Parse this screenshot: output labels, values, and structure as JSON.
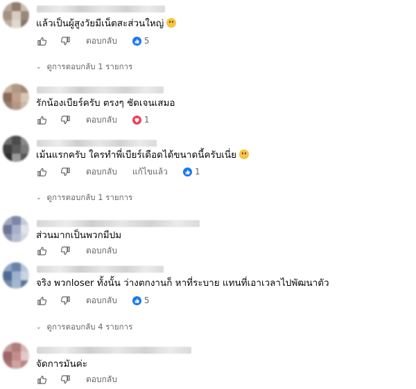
{
  "ui": {
    "reply_label": "ตอบกลับ",
    "edited_label": "แก้ไขแล้ว",
    "chevron": "⌄"
  },
  "comments": [
    {
      "text": "แล้วเป็นผู้สูงวัยมีเน็ตสะส่วนใหญ่",
      "emoji": "grinning-face-emoji",
      "reaction": {
        "type": "like",
        "count": "5"
      },
      "replies_label": "ดูการตอบกลับ 1 รายการ",
      "avatar_colors": [
        "#b8a79a",
        "#8f7c6e",
        "#cbbfb4",
        "#a39184",
        "#d8cdc3",
        "#97887c",
        "#bfae9f",
        "#e1d9d1",
        "#877666"
      ]
    },
    {
      "text": "รักน้องเบียร์ครับ ตรงๆ ชัดเจนเสมอ",
      "reaction": {
        "type": "love",
        "count": "1"
      },
      "avatar_colors": [
        "#c9b3a2",
        "#b39683",
        "#a48676",
        "#8b6a5a",
        "#c2a089",
        "#d9c5b6",
        "#9a7a6b",
        "#b49786",
        "#cdb6a5"
      ]
    },
    {
      "text": "เม้นแรกครับ ใครทำพี่เบียร์เดือดได้ขนาดนี้ครับเนี่ย",
      "emoji": "astonished-face-emoji",
      "edited": true,
      "reaction": {
        "type": "like",
        "count": "1"
      },
      "replies_label": "ดูการตอบกลับ 1 รายการ",
      "avatar_colors": [
        "#6e6e6e",
        "#4b4b4b",
        "#8a8a8a",
        "#3e3e3e",
        "#5c5c5c",
        "#7a7a7a",
        "#2f2f2f",
        "#9a9a9a",
        "#565656"
      ]
    },
    {
      "text": "ส่วนมากเป็นพวกมีปม",
      "avatar_colors": [
        "#9fa7c0",
        "#7b86a8",
        "#c5cad8",
        "#6d7596",
        "#a9b1c8",
        "#e0e3ea",
        "#8c93ad",
        "#b7bdd0",
        "#d2d5df"
      ]
    },
    {
      "text": "จริง พวกloser ทั้งนั้น ว่างตกงานก็ หาที่ระบาย แทนที่เอาเวลาไปพัฒนาตัว",
      "reaction": {
        "type": "like",
        "count": "5"
      },
      "replies_label": "ดูการตอบกลับ 4 รายการ",
      "avatar_colors": [
        "#8da4c4",
        "#6a83a8",
        "#b6c4d9",
        "#4f6b93",
        "#9db2ce",
        "#c9d3e2",
        "#738aab",
        "#a5b7cf",
        "#5d7499"
      ]
    },
    {
      "text": "จัดการมันค่ะ",
      "avatar_colors": [
        "#c79a9a",
        "#b07c7c",
        "#d9b3b3",
        "#9e6666",
        "#c48c8c",
        "#e5c9c9",
        "#a87373",
        "#cfa3a3",
        "#b88585"
      ]
    }
  ]
}
